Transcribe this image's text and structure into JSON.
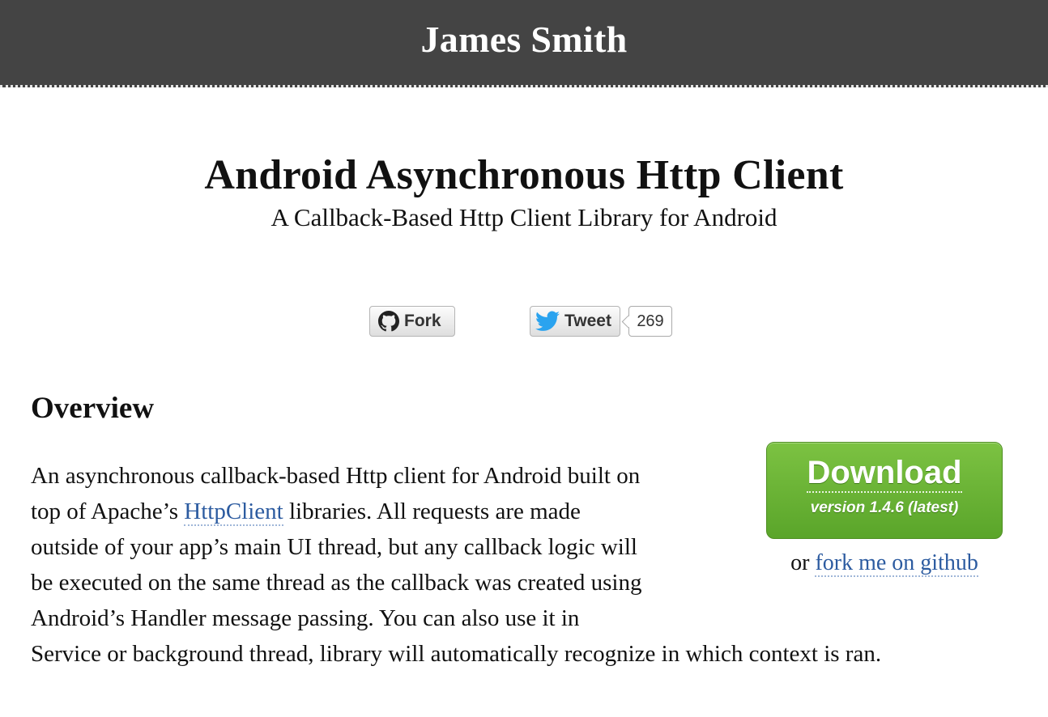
{
  "topbar": {
    "site_title": "James Smith"
  },
  "header": {
    "title": "Android Asynchronous Http Client",
    "subtitle": "A Callback-Based Http Client Library for Android"
  },
  "social": {
    "fork_label": "Fork",
    "fork_icon": "github-icon",
    "tweet_label": "Tweet",
    "tweet_icon": "twitter-bird-icon",
    "tweet_count": "269"
  },
  "overview": {
    "heading": "Overview",
    "lines": [
      [
        "An asynchronous callback-based Http client for Android built on"
      ],
      [
        "top of Apache’s ",
        "HttpClient",
        " libraries. All requests are made"
      ],
      [
        "outside of your app’s main UI thread, but any callback logic will"
      ],
      [
        "be executed on the same thread as the callback was created using"
      ],
      [
        "Android’s Handler message passing. You can also use it in"
      ],
      [
        "Service or background thread, library will automatically recognize in which context is ran."
      ]
    ]
  },
  "download": {
    "label": "Download",
    "version": "version 1.4.6 (latest)",
    "alt_prefix": "or ",
    "alt_link": "fork me on github"
  },
  "colors": {
    "topbar_bg": "#444444",
    "link": "#2c5ba0",
    "download_green": "#6ab536"
  }
}
